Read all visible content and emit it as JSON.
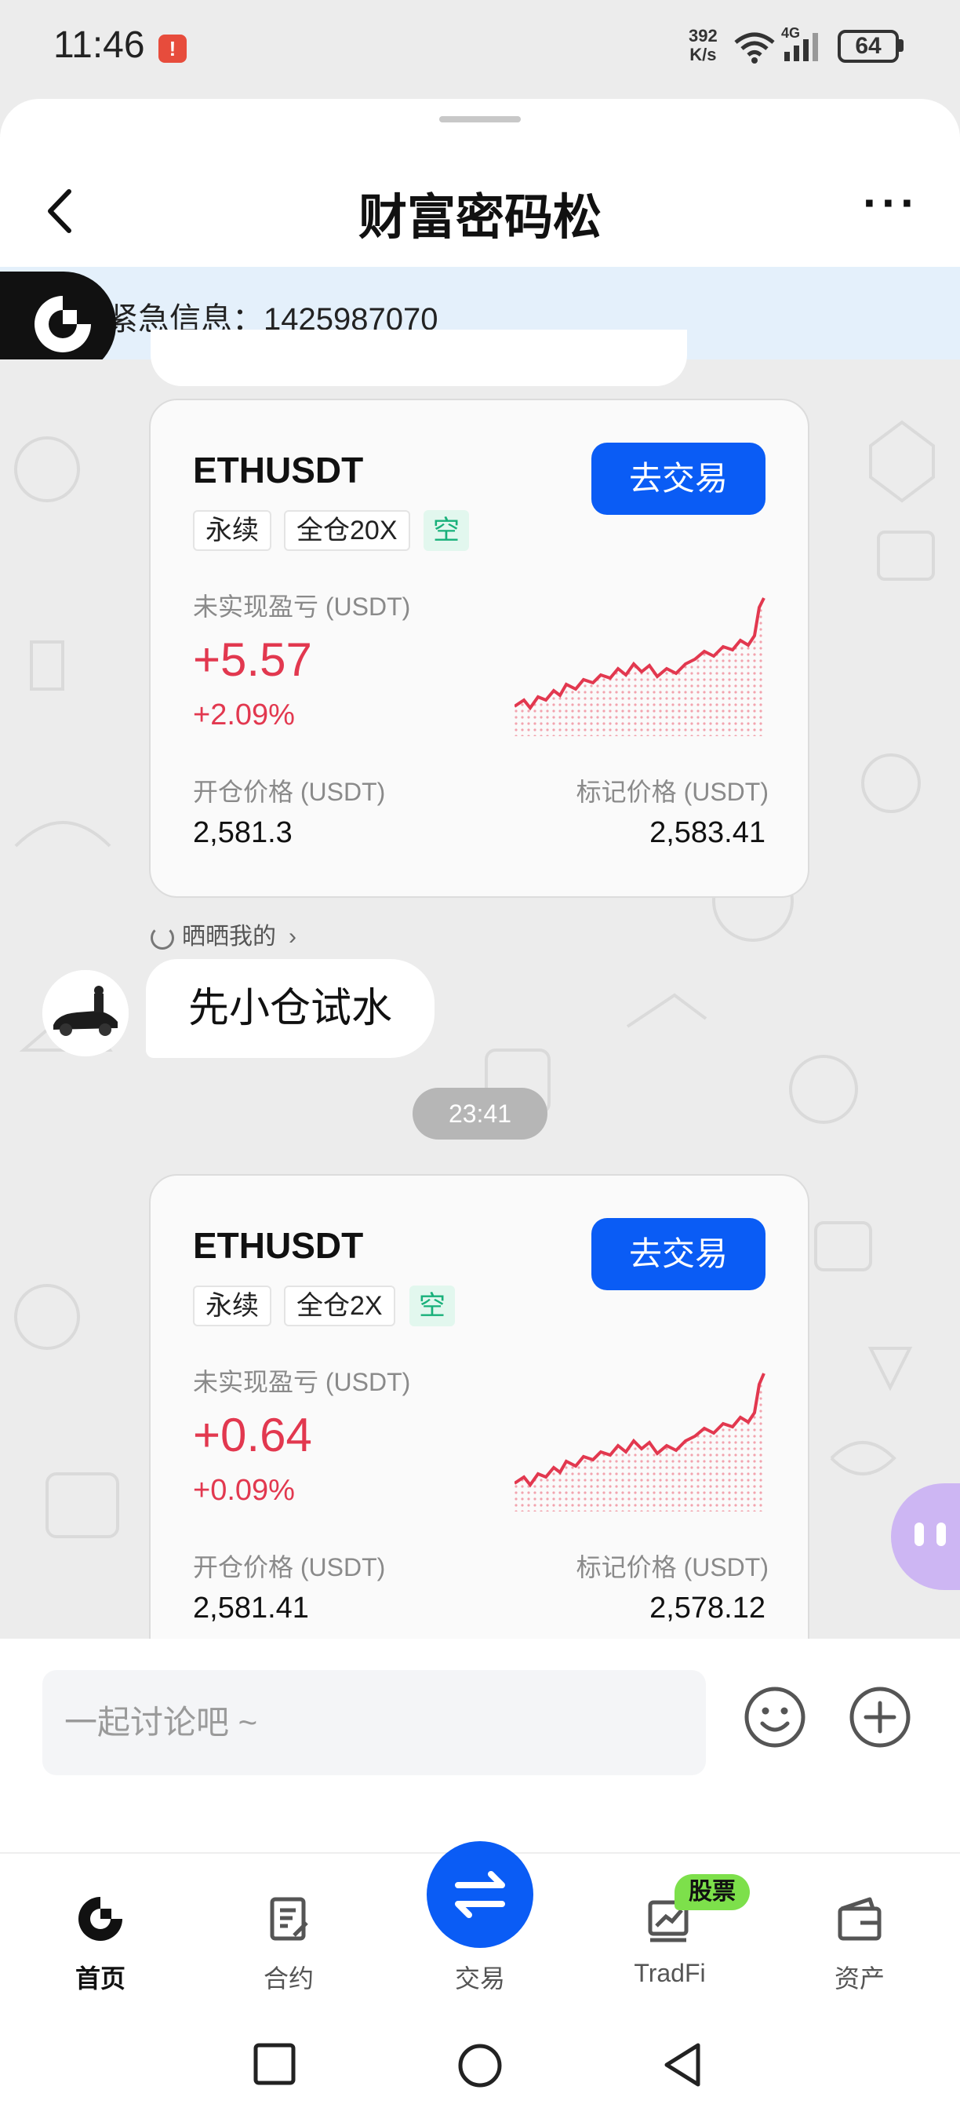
{
  "status_bar": {
    "time": "11:46",
    "alert_glyph": "!",
    "net_speed_value": "392",
    "net_speed_unit": "K/s",
    "network": "4G",
    "battery": "64",
    "icons": [
      "alert-icon",
      "wifi-icon",
      "signal-icon",
      "battery-icon"
    ]
  },
  "header": {
    "title": "财富密码松",
    "back_icon": "chevron-left-icon",
    "more_label": "···"
  },
  "notice": {
    "text": "紧急信息：1425987070",
    "logo_icon": "gate-logo-icon"
  },
  "cards": [
    {
      "symbol": "ETHUSDT",
      "trade_button": "去交易",
      "tags": [
        "永续",
        "全仓20X"
      ],
      "direction": "空",
      "pnl_label": "未实现盈亏 (USDT)",
      "pnl_value": "+5.57",
      "pnl_percent": "+2.09%",
      "open_price_label": "开仓价格 (USDT)",
      "open_price": "2,581.3",
      "mark_price_label": "标记价格 (USDT)",
      "mark_price": "2,583.41"
    },
    {
      "symbol": "ETHUSDT",
      "trade_button": "去交易",
      "tags": [
        "永续",
        "全仓2X"
      ],
      "direction": "空",
      "pnl_label": "未实现盈亏 (USDT)",
      "pnl_value": "+0.64",
      "pnl_percent": "+0.09%",
      "open_price_label": "开仓价格 (USDT)",
      "open_price": "2,581.41",
      "mark_price_label": "标记价格 (USDT)",
      "mark_price": "2,578.12"
    }
  ],
  "share_link": "晒晒我的",
  "message": "先小仓试水",
  "timestamp": "23:41",
  "input": {
    "placeholder": "一起讨论吧 ~"
  },
  "tabs": [
    {
      "label": "首页",
      "icon": "home-gate-icon",
      "active": true
    },
    {
      "label": "合约",
      "icon": "contract-icon",
      "active": false
    },
    {
      "label": "交易",
      "icon": "swap-icon",
      "active": false
    },
    {
      "label": "TradFi",
      "icon": "tradfi-chart-icon",
      "active": false,
      "badge": "股票"
    },
    {
      "label": "资产",
      "icon": "wallet-icon",
      "active": false
    }
  ],
  "colors": {
    "brand_blue": "#0a5cf5",
    "profit_red": "#e2384f",
    "short_green": "#18b07a",
    "notice_bg": "#e4f0fb"
  }
}
